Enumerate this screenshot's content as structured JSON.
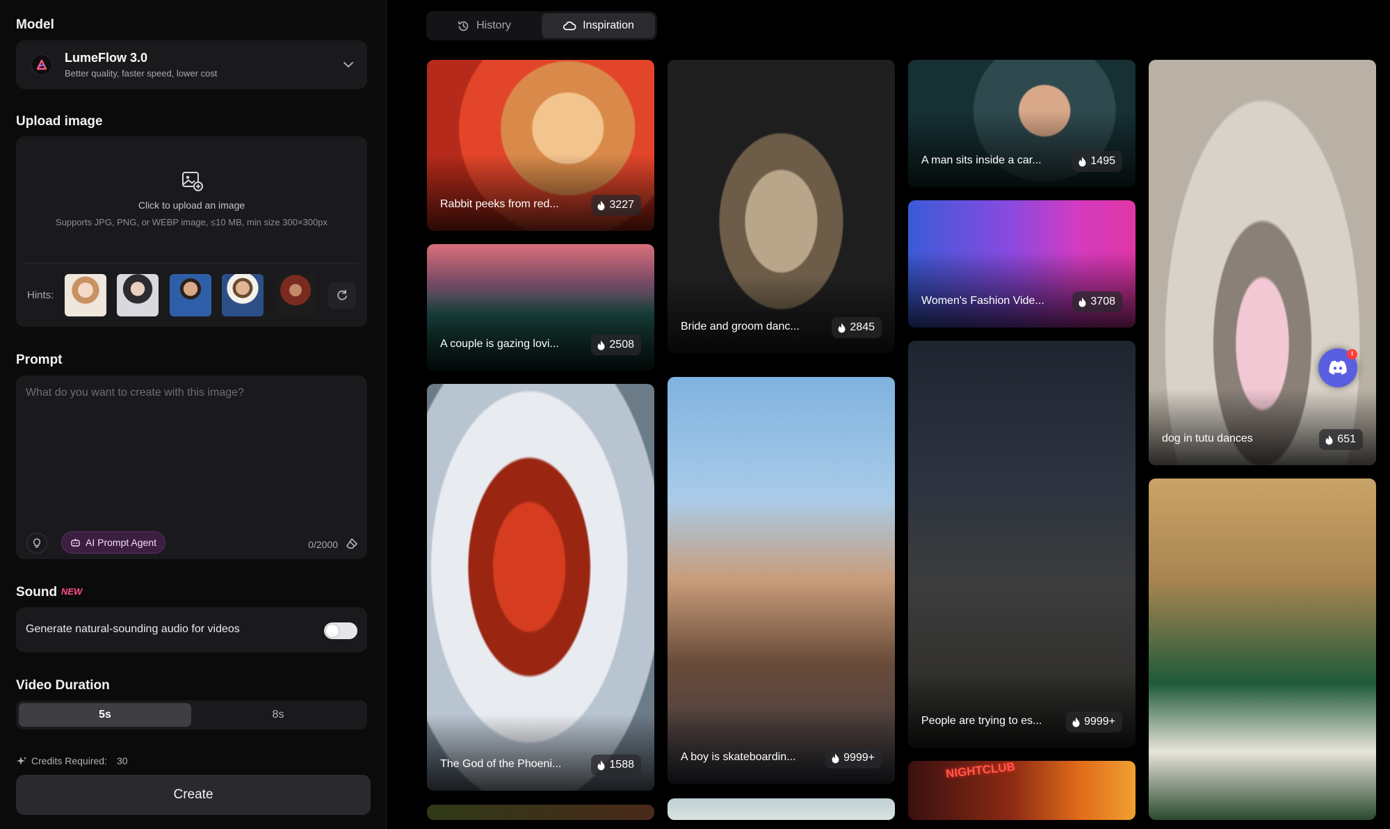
{
  "model": {
    "section_title": "Model",
    "name": "LumeFlow 3.0",
    "description": "Better quality, faster speed, lower cost"
  },
  "upload": {
    "section_title": "Upload image",
    "main_text": "Click to upload an image",
    "sub_text": "Supports JPG, PNG, or WEBP image, ≤10 MB, min size 300×300px",
    "hints_label": "Hints:"
  },
  "prompt": {
    "section_title": "Prompt",
    "placeholder": "What do you want to create with this image?",
    "agent_label": "AI Prompt Agent",
    "char_count": "0/2000"
  },
  "sound": {
    "section_title": "Sound",
    "badge": "NEW",
    "toggle_label": "Generate natural-sounding audio for videos",
    "toggle_on": true
  },
  "duration": {
    "section_title": "Video Duration",
    "options": [
      "5s",
      "8s"
    ],
    "selected": "5s"
  },
  "credits": {
    "label": "Credits Required:",
    "value": "30"
  },
  "create_label": "Create",
  "tabs": {
    "history": "History",
    "inspiration": "Inspiration",
    "active": "Inspiration"
  },
  "gallery": [
    {
      "title": "Rabbit peeks from red...",
      "count": "3227"
    },
    {
      "title": "A couple is gazing lovi...",
      "count": "2508"
    },
    {
      "title": "The God of the Phoeni...",
      "count": "1588"
    },
    {
      "title": "Bride and groom danc...",
      "count": "2845"
    },
    {
      "title": "A boy is skateboardin...",
      "count": "9999+"
    },
    {
      "title": "A man sits inside a car...",
      "count": "1495"
    },
    {
      "title": "Women's Fashion Vide...",
      "count": "3708"
    },
    {
      "title": "People are trying to es...",
      "count": "9999+"
    },
    {
      "title": "dog in tutu dances",
      "count": "651"
    },
    {
      "title": "NIGHTCLUB",
      "count": ""
    }
  ],
  "colors": {
    "accent_pink": "#ff4d88",
    "agent_purple": "#3c1e42",
    "discord": "#5a5ee0"
  }
}
